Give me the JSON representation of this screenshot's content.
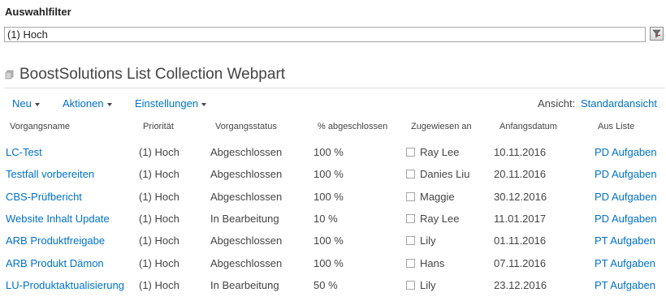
{
  "filter": {
    "title": "Auswahlfilter",
    "value": "(1) Hoch",
    "button_icon": "filter-icon"
  },
  "webpart": {
    "title": "BoostSolutions List Collection Webpart",
    "icon": "webpart-icon"
  },
  "toolbar": {
    "new_label": "Neu",
    "actions_label": "Aktionen",
    "settings_label": "Einstellungen",
    "view_label": "Ansicht:",
    "view_value": "Standardansicht"
  },
  "columns": [
    "Vorgangsname",
    "Priorität",
    "Vorgangsstatus",
    "% abgeschlossen",
    "Zugewiesen an",
    "Anfangsdatum",
    "Aus Liste"
  ],
  "rows": [
    {
      "name": "LC-Test",
      "priority": "(1) Hoch",
      "status": "Abgeschlossen",
      "percent": "100 %",
      "assigned": "Ray Lee",
      "date": "10.11.2016",
      "list": "PD Aufgaben"
    },
    {
      "name": "Testfall vorbereiten",
      "priority": "(1) Hoch",
      "status": "Abgeschlossen",
      "percent": "100 %",
      "assigned": "Danies Liu",
      "date": "20.11.2016",
      "list": "PD Aufgaben"
    },
    {
      "name": "CBS-Prüfbericht",
      "priority": "(1) Hoch",
      "status": "Abgeschlossen",
      "percent": "100 %",
      "assigned": "Maggie",
      "date": "30.12.2016",
      "list": "PD Aufgaben"
    },
    {
      "name": "Website Inhalt Update",
      "priority": "(1) Hoch",
      "status": "In Bearbeitung",
      "percent": "10 %",
      "assigned": "Ray Lee",
      "date": "11.01.2017",
      "list": "PD Aufgaben"
    },
    {
      "name": "ARB Produktfreigabe",
      "priority": "(1) Hoch",
      "status": "Abgeschlossen",
      "percent": "100 %",
      "assigned": "Lily",
      "date": "01.11.2016",
      "list": "PT Aufgaben"
    },
    {
      "name": "ARB Produkt Dämon",
      "priority": "(1) Hoch",
      "status": "Abgeschlossen",
      "percent": "100 %",
      "assigned": "Hans",
      "date": "07.11.2016",
      "list": "PT Aufgaben"
    },
    {
      "name": "LU-Produktaktualisierung",
      "priority": "(1) Hoch",
      "status": "In Bearbeitung",
      "percent": "50 %",
      "assigned": "Lily",
      "date": "23.12.2016",
      "list": "PT Aufgaben"
    }
  ],
  "colors": {
    "link": "#0072c6",
    "text": "#444444"
  }
}
